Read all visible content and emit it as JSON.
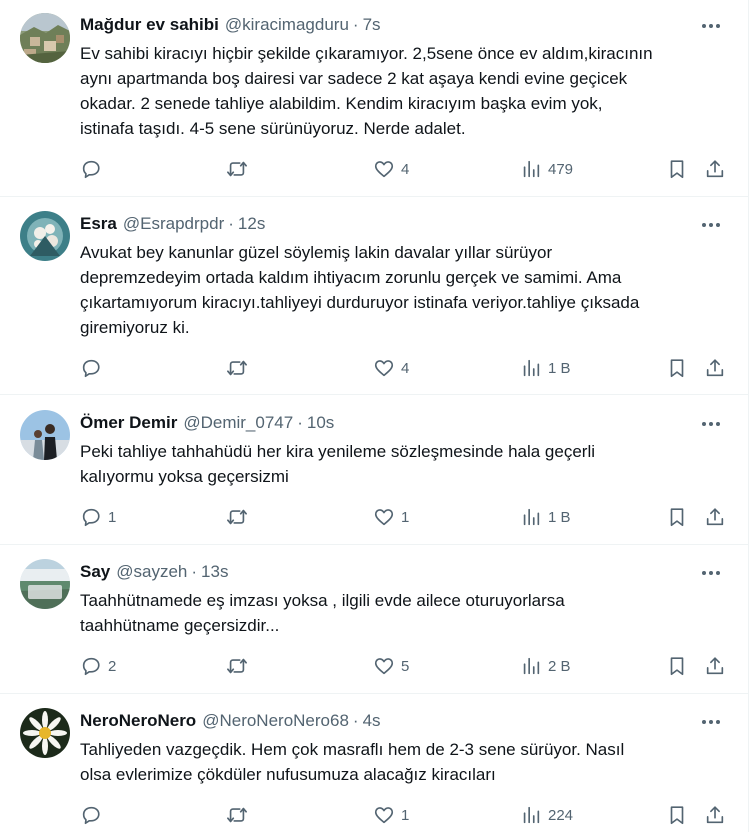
{
  "tweets": [
    {
      "name": "Mağdur ev sahibi",
      "handle": "@kiracimagduru",
      "time": "7s",
      "text": "Ev sahibi kiracıyı hiçbir şekilde çıkaramıyor. 2,5sene önce ev aldım,kiracının\naynı apartmanda boş dairesi var sadece 2 kat aşaya kendi evine geçicek\nokadar. 2 senede tahliye alabildim. Kendim kiracıyım başka evim yok,\nistinafa taşıdı. 4-5 sene sürünüyoruz. Nerde adalet.",
      "replies": "",
      "retweets": "",
      "likes": "4",
      "views": "479"
    },
    {
      "name": "Esra",
      "handle": "@Esrapdrpdr",
      "time": "12s",
      "text": "Avukat bey kanunlar güzel söylemiş lakin davalar yıllar sürüyor\ndepremzedeyim ortada kaldım ihtiyacım zorunlu gerçek ve samimi. Ama\nçıkartamıyorum kiracıyı.tahliyeyi durduruyor istinafa veriyor.tahliye çıksada\ngiremiyoruz ki.",
      "replies": "",
      "retweets": "",
      "likes": "4",
      "views": "1 B"
    },
    {
      "name": "Ömer Demir",
      "handle": "@Demir_0747",
      "time": "10s",
      "text": "Peki tahliye tahhahüdü her kira yenileme sözleşmesinde hala geçerli\nkalıyormu yoksa geçersizmi",
      "replies": "1",
      "retweets": "",
      "likes": "1",
      "views": "1 B"
    },
    {
      "name": "Say",
      "handle": "@sayzeh",
      "time": "13s",
      "text": "Taahhütnamede eş imzası yoksa , ilgili evde ailece oturuyorlarsa\ntaahhütname geçersizdir...",
      "replies": "2",
      "retweets": "",
      "likes": "5",
      "views": "2 B"
    },
    {
      "name": "NeroNeroNero",
      "handle": "@NeroNeroNero68",
      "time": "4s",
      "text": "Tahliyeden vazgeçdik. Hem çok masraflı hem de 2-3 sene sürüyor. Nasıl\nolsa evlerimize çökdüler nufusumuza alacağız kiracıları",
      "replies": "",
      "retweets": "",
      "likes": "1",
      "views": "224"
    }
  ],
  "separator": "·",
  "icons": {
    "more": "more-horizontal-icon",
    "reply": "reply-icon",
    "retweet": "retweet-icon",
    "like": "heart-icon",
    "views": "views-chart-icon",
    "bookmark": "bookmark-icon",
    "share": "share-icon"
  },
  "colors": {
    "text": "#0f1419",
    "secondary": "#536471",
    "divider": "#eff3f4"
  }
}
